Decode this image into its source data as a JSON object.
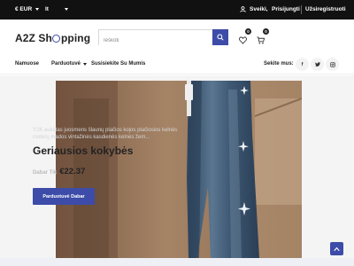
{
  "topbar": {
    "currency": "€ EUR",
    "language": "lt",
    "greeting": "Sveiki,",
    "login": "Prisijungti",
    "register": "Užsiregistruoti"
  },
  "header": {
    "logo_prefix": "A2Z",
    "logo_sh": "Sh",
    "logo_suffix": "pping",
    "search_placeholder": "Ieškoti",
    "wishlist_count": "0",
    "cart_count": "0"
  },
  "nav": {
    "items": [
      {
        "label": "Namuose"
      },
      {
        "label": "Parduotuvė"
      },
      {
        "label": "Susisiekite Su Mumis"
      }
    ],
    "follow_label": "Sekite mus:",
    "social": [
      "f",
      "t",
      "ig"
    ]
  },
  "hero": {
    "subtitle": "Y2K aukštas juosmens šlaunų plačios kojos plačiosios kelnės moterų mados vintažinės kasdienės kelnės žem...",
    "title": "Geriausios kokybės",
    "price_label": "Dabar Tik",
    "price": "€22.37",
    "button": "Parduotuvė Dabar"
  },
  "colors": {
    "accent": "#3c4ca8",
    "topbar": "#111111"
  }
}
